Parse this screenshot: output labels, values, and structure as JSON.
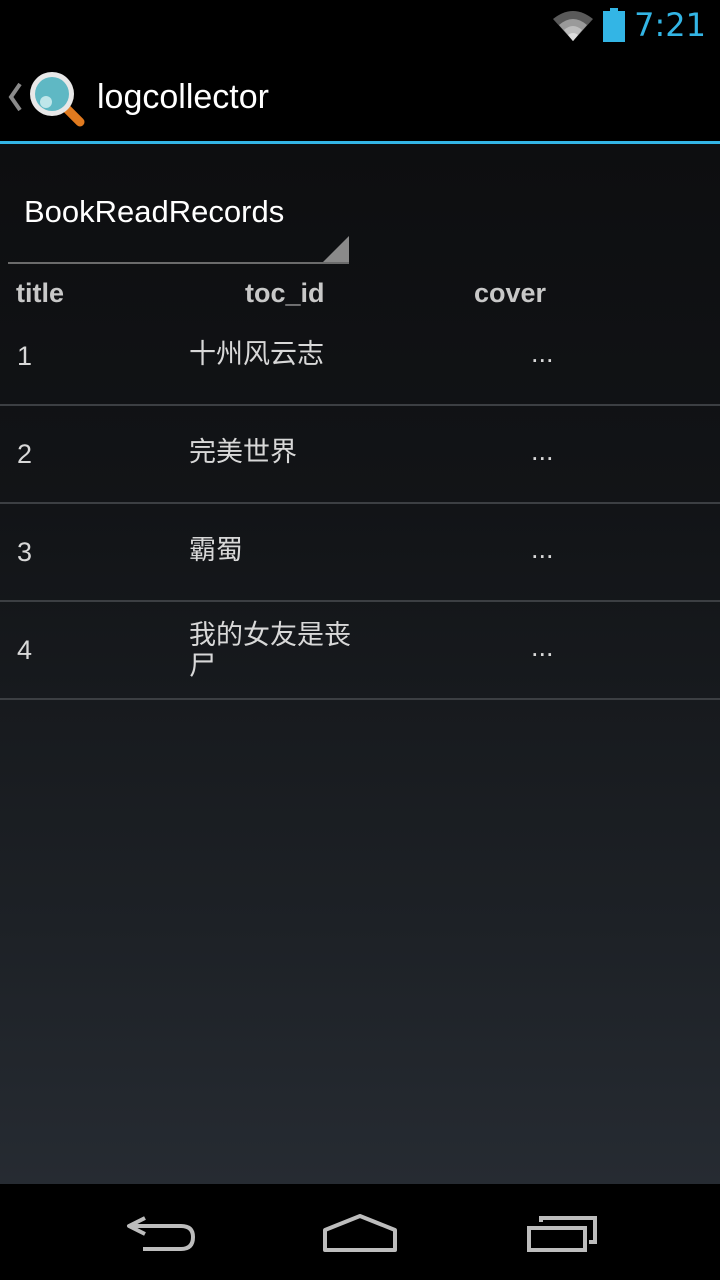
{
  "status_bar": {
    "time": "7:21",
    "icons": [
      "wifi-icon",
      "battery-icon"
    ],
    "accent_color": "#33b5e5"
  },
  "action_bar": {
    "title": "logcollector",
    "icons": [
      "back-chevron-icon",
      "magnifier-app-icon"
    ],
    "divider_color": "#33b5e5"
  },
  "table_selector": {
    "selected": "BookReadRecords"
  },
  "table": {
    "columns": [
      "title",
      "toc_id",
      "cover"
    ],
    "rows": [
      {
        "index": "1",
        "name": "十州风云志",
        "cover": "..."
      },
      {
        "index": "2",
        "name": "完美世界",
        "cover": "..."
      },
      {
        "index": "3",
        "name": "霸蜀",
        "cover": "..."
      },
      {
        "index": "4",
        "name": "我的女友是丧尸",
        "cover": "..."
      }
    ]
  },
  "nav_bar": {
    "icons": [
      "back-arrow-icon",
      "home-icon",
      "recent-apps-icon"
    ]
  }
}
